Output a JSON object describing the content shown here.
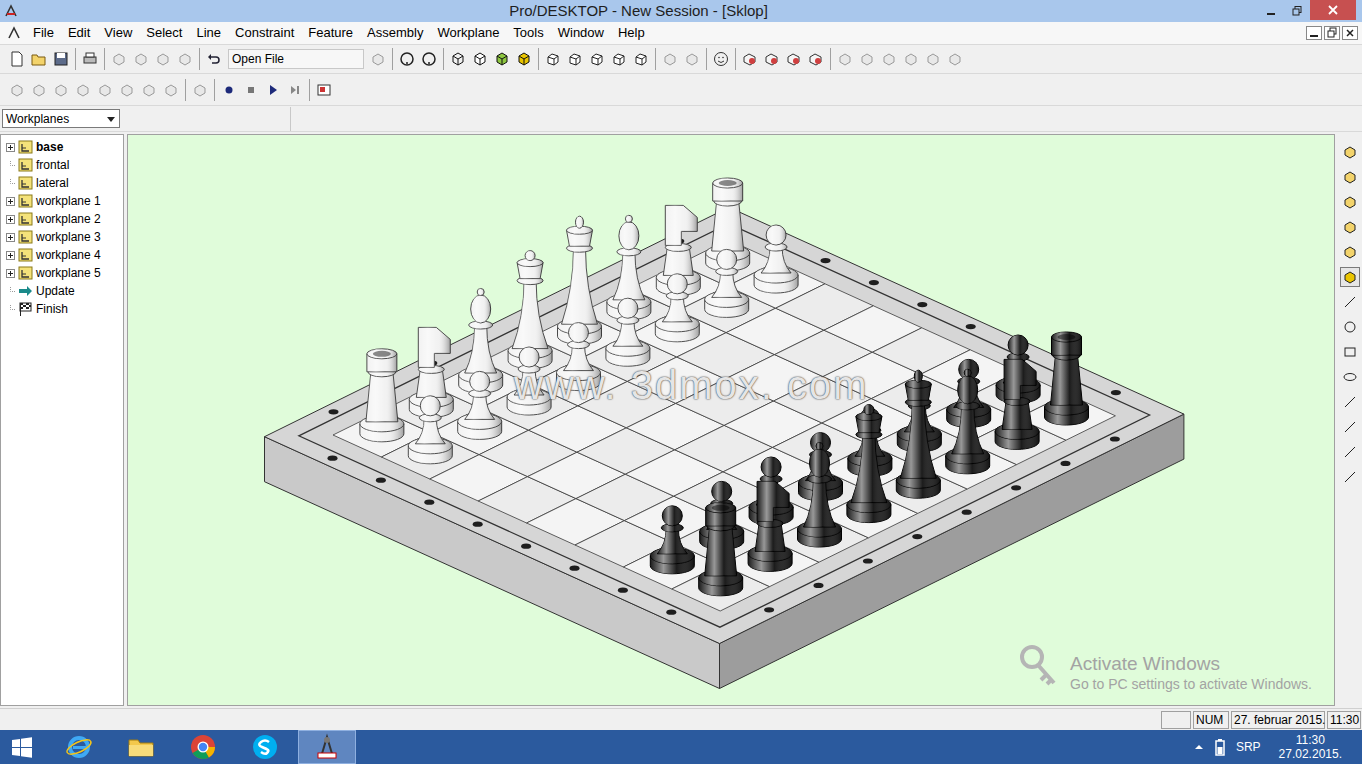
{
  "window": {
    "title": "Pro/DESKTOP - New Session - [Sklop]"
  },
  "menu": [
    "File",
    "Edit",
    "View",
    "Select",
    "Line",
    "Constraint",
    "Feature",
    "Assembly",
    "Workplane",
    "Tools",
    "Window",
    "Help"
  ],
  "toolbar": {
    "open_file": "Open File"
  },
  "browser_dropdown": "Workplanes",
  "tree": [
    {
      "label": "base",
      "kind": "workplane",
      "expandable": true,
      "bold": true
    },
    {
      "label": "frontal",
      "kind": "workplane",
      "expandable": false,
      "bold": false
    },
    {
      "label": "lateral",
      "kind": "workplane",
      "expandable": false,
      "bold": false
    },
    {
      "label": "workplane 1",
      "kind": "workplane",
      "expandable": true,
      "bold": false
    },
    {
      "label": "workplane 2",
      "kind": "workplane",
      "expandable": true,
      "bold": false
    },
    {
      "label": "workplane 3",
      "kind": "workplane",
      "expandable": true,
      "bold": false
    },
    {
      "label": "workplane 4",
      "kind": "workplane",
      "expandable": true,
      "bold": false
    },
    {
      "label": "workplane 5",
      "kind": "workplane",
      "expandable": true,
      "bold": false
    },
    {
      "label": "Update",
      "kind": "update",
      "expandable": false,
      "bold": false
    },
    {
      "label": "Finish",
      "kind": "finish",
      "expandable": false,
      "bold": false
    }
  ],
  "pieces": [
    {
      "kind": "rook",
      "color": "#f2f2f2",
      "file": 0,
      "rank": 0
    },
    {
      "kind": "knight",
      "color": "#f2f2f2",
      "file": 1,
      "rank": 0
    },
    {
      "kind": "bishop",
      "color": "#f2f2f2",
      "file": 2,
      "rank": 0
    },
    {
      "kind": "queen",
      "color": "#f2f2f2",
      "file": 3,
      "rank": 0
    },
    {
      "kind": "king",
      "color": "#f2f2f2",
      "file": 4,
      "rank": 0
    },
    {
      "kind": "bishop",
      "color": "#f2f2f2",
      "file": 5,
      "rank": 0
    },
    {
      "kind": "knight",
      "color": "#f2f2f2",
      "file": 6,
      "rank": 0
    },
    {
      "kind": "rook",
      "color": "#f2f2f2",
      "file": 7,
      "rank": 0
    },
    {
      "kind": "pawn",
      "color": "#f2f2f2",
      "file": 0,
      "rank": 1
    },
    {
      "kind": "pawn",
      "color": "#f2f2f2",
      "file": 1,
      "rank": 1
    },
    {
      "kind": "pawn",
      "color": "#f2f2f2",
      "file": 2,
      "rank": 1
    },
    {
      "kind": "pawn",
      "color": "#f2f2f2",
      "file": 3,
      "rank": 1
    },
    {
      "kind": "pawn",
      "color": "#f2f2f2",
      "file": 4,
      "rank": 1
    },
    {
      "kind": "pawn",
      "color": "#f2f2f2",
      "file": 5,
      "rank": 1
    },
    {
      "kind": "pawn",
      "color": "#f2f2f2",
      "file": 6,
      "rank": 1
    },
    {
      "kind": "pawn",
      "color": "#f2f2f2",
      "file": 7,
      "rank": 1
    },
    {
      "kind": "pawn",
      "color": "#1c1c1c",
      "file": 0,
      "rank": 6
    },
    {
      "kind": "pawn",
      "color": "#1c1c1c",
      "file": 1,
      "rank": 6
    },
    {
      "kind": "pawn",
      "color": "#1c1c1c",
      "file": 2,
      "rank": 6
    },
    {
      "kind": "pawn",
      "color": "#1c1c1c",
      "file": 3,
      "rank": 6
    },
    {
      "kind": "pawn",
      "color": "#1c1c1c",
      "file": 4,
      "rank": 6
    },
    {
      "kind": "pawn",
      "color": "#1c1c1c",
      "file": 5,
      "rank": 6
    },
    {
      "kind": "pawn",
      "color": "#1c1c1c",
      "file": 6,
      "rank": 6
    },
    {
      "kind": "pawn",
      "color": "#1c1c1c",
      "file": 7,
      "rank": 6
    },
    {
      "kind": "rook",
      "color": "#1c1c1c",
      "file": 0,
      "rank": 7
    },
    {
      "kind": "knight",
      "color": "#1c1c1c",
      "file": 1,
      "rank": 7
    },
    {
      "kind": "bishop",
      "color": "#1c1c1c",
      "file": 2,
      "rank": 7
    },
    {
      "kind": "queen",
      "color": "#1c1c1c",
      "file": 3,
      "rank": 7
    },
    {
      "kind": "king",
      "color": "#1c1c1c",
      "file": 4,
      "rank": 7
    },
    {
      "kind": "bishop",
      "color": "#1c1c1c",
      "file": 5,
      "rank": 7
    },
    {
      "kind": "knight",
      "color": "#1c1c1c",
      "file": 6,
      "rank": 7
    },
    {
      "kind": "rook",
      "color": "#1c1c1c",
      "file": 7,
      "rank": 7
    }
  ],
  "watermark": "www. 3dmox. com",
  "activation": {
    "title": "Activate Windows",
    "subtitle": "Go to PC settings to activate Windows."
  },
  "status_bar": {
    "num": "NUM",
    "date": "27. februar 2015.",
    "time": "11:30"
  },
  "taskbar": {
    "apps": [
      {
        "kind": "internet-explorer",
        "selected": false
      },
      {
        "kind": "file-explorer",
        "selected": false
      },
      {
        "kind": "chrome",
        "selected": false
      },
      {
        "kind": "skype",
        "selected": false
      },
      {
        "kind": "pro-desktop",
        "selected": true
      }
    ],
    "language": "SRP",
    "time": "11:30",
    "date": "27.02.2015."
  }
}
